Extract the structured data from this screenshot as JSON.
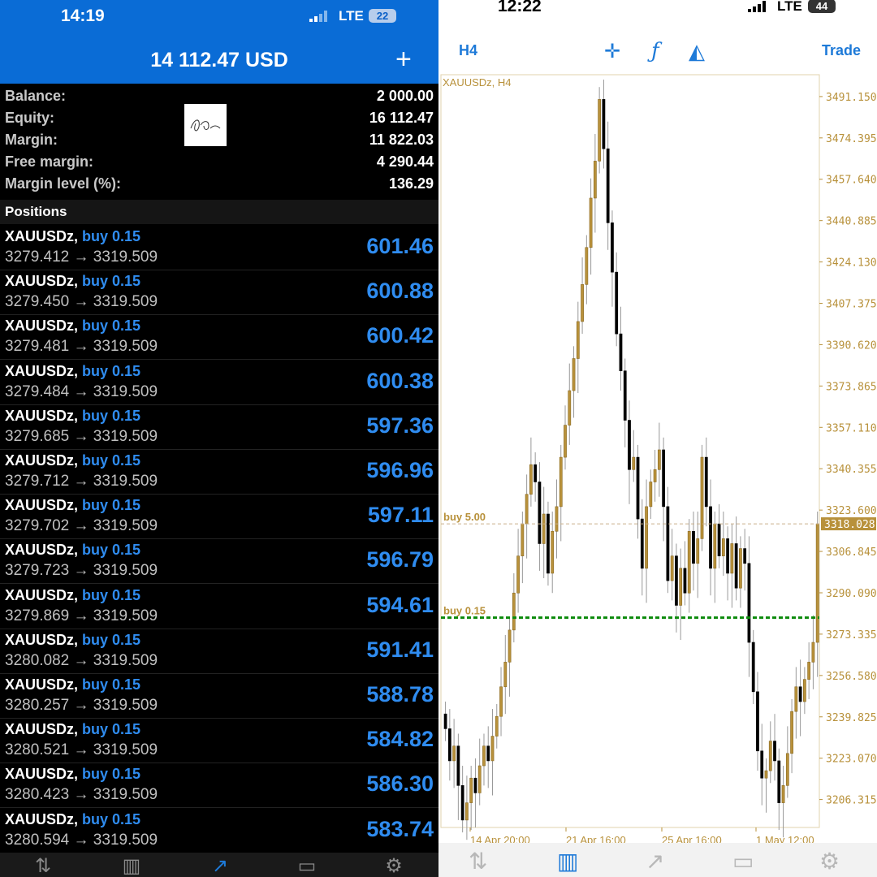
{
  "left_status": {
    "time": "14:19",
    "network": "LTE",
    "battery": "22"
  },
  "account": {
    "header_title": "14 112.47 USD",
    "rows": [
      {
        "label": "Balance:",
        "value": "2 000.00"
      },
      {
        "label": "Equity:",
        "value": "16 112.47"
      },
      {
        "label": "Margin:",
        "value": "11 822.03"
      },
      {
        "label": "Free margin:",
        "value": "4 290.44"
      },
      {
        "label": "Margin level (%):",
        "value": "136.29"
      }
    ],
    "positions_title": "Positions"
  },
  "positions": [
    {
      "symbol": "XAUUSDz,",
      "side": "buy 0.15",
      "prices": "3279.412 → 3319.509",
      "pl": "601.46"
    },
    {
      "symbol": "XAUUSDz,",
      "side": "buy 0.15",
      "prices": "3279.450 → 3319.509",
      "pl": "600.88"
    },
    {
      "symbol": "XAUUSDz,",
      "side": "buy 0.15",
      "prices": "3279.481 → 3319.509",
      "pl": "600.42"
    },
    {
      "symbol": "XAUUSDz,",
      "side": "buy 0.15",
      "prices": "3279.484 → 3319.509",
      "pl": "600.38"
    },
    {
      "symbol": "XAUUSDz,",
      "side": "buy 0.15",
      "prices": "3279.685 → 3319.509",
      "pl": "597.36"
    },
    {
      "symbol": "XAUUSDz,",
      "side": "buy 0.15",
      "prices": "3279.712 → 3319.509",
      "pl": "596.96"
    },
    {
      "symbol": "XAUUSDz,",
      "side": "buy 0.15",
      "prices": "3279.702 → 3319.509",
      "pl": "597.11"
    },
    {
      "symbol": "XAUUSDz,",
      "side": "buy 0.15",
      "prices": "3279.723 → 3319.509",
      "pl": "596.79"
    },
    {
      "symbol": "XAUUSDz,",
      "side": "buy 0.15",
      "prices": "3279.869 → 3319.509",
      "pl": "594.61"
    },
    {
      "symbol": "XAUUSDz,",
      "side": "buy 0.15",
      "prices": "3280.082 → 3319.509",
      "pl": "591.41"
    },
    {
      "symbol": "XAUUSDz,",
      "side": "buy 0.15",
      "prices": "3280.257 → 3319.509",
      "pl": "588.78"
    },
    {
      "symbol": "XAUUSDz,",
      "side": "buy 0.15",
      "prices": "3280.521 → 3319.509",
      "pl": "584.82"
    },
    {
      "symbol": "XAUUSDz,",
      "side": "buy 0.15",
      "prices": "3280.423 → 3319.509",
      "pl": "586.30"
    },
    {
      "symbol": "XAUUSDz,",
      "side": "buy 0.15",
      "prices": "3280.594 → 3319.509",
      "pl": "583.74"
    }
  ],
  "right_status": {
    "time": "12:22",
    "network": "LTE",
    "battery": "44"
  },
  "chart_toolbar": {
    "timeframe": "H4",
    "trade": "Trade"
  },
  "chart_data": {
    "type": "candlestick",
    "title": "XAUUSDz, H4",
    "y_ticks": [
      "3491.150",
      "3474.395",
      "3457.640",
      "3440.885",
      "3424.130",
      "3407.375",
      "3390.620",
      "3373.865",
      "3357.110",
      "3340.355",
      "3323.600",
      "3306.845",
      "3290.090",
      "3273.335",
      "3256.580",
      "3239.825",
      "3223.070",
      "3206.315"
    ],
    "x_ticks": [
      "14 Apr 20:00",
      "21 Apr 16:00",
      "25 Apr 16:00",
      "1 May 12:00"
    ],
    "ylim": [
      3195,
      3500
    ],
    "current_price": "3318.028",
    "current_price_value": 3318.028,
    "orders": [
      {
        "label": "buy 5.00",
        "price": 3318.0
      },
      {
        "label": "buy 0.15",
        "price": 3280.0
      }
    ],
    "colors": {
      "up": "#b8913b",
      "down": "#000000",
      "order_line": "#0a8a0a",
      "axis": "#b8913b"
    },
    "closes": [
      3235,
      3222,
      3228,
      3212,
      3198,
      3205,
      3215,
      3209,
      3220,
      3228,
      3222,
      3232,
      3240,
      3252,
      3262,
      3275,
      3290,
      3305,
      3318,
      3330,
      3342,
      3335,
      3310,
      3322,
      3298,
      3315,
      3325,
      3345,
      3358,
      3372,
      3385,
      3400,
      3415,
      3430,
      3450,
      3465,
      3490,
      3470,
      3440,
      3420,
      3395,
      3380,
      3360,
      3340,
      3345,
      3320,
      3300,
      3325,
      3335,
      3340,
      3348,
      3325,
      3295,
      3305,
      3285,
      3300,
      3290,
      3315,
      3302,
      3312,
      3345,
      3325,
      3300,
      3318,
      3305,
      3312,
      3298,
      3310,
      3292,
      3308,
      3302,
      3270,
      3250,
      3226,
      3215,
      3218,
      3230,
      3222,
      3205,
      3212,
      3225,
      3242,
      3252,
      3246,
      3255,
      3262,
      3270,
      3318
    ]
  },
  "tabs_left": [
    "quotes-icon",
    "chart-icon",
    "trade-icon",
    "history-icon",
    "settings-icon"
  ],
  "tabs_right": [
    "quotes-icon",
    "chart-icon",
    "trade-icon",
    "history-icon",
    "settings-icon"
  ]
}
